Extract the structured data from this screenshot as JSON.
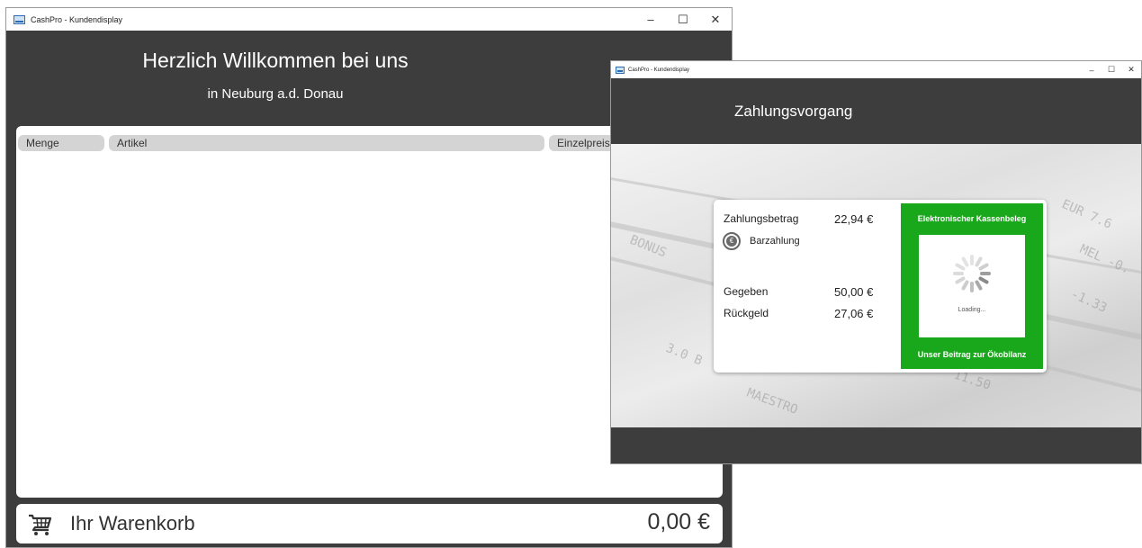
{
  "window1": {
    "title": "CashPro - Kundendisplay",
    "controls": {
      "minimize": "–",
      "maximize": "☐",
      "close": "✕"
    },
    "header": {
      "line1": "Herzlich Willkommen bei uns",
      "line2": "in Neuburg a.d. Donau"
    },
    "table": {
      "columns": [
        "Menge",
        "Artikel",
        "Einzelpreis"
      ]
    },
    "footer": {
      "cart_label": "Ihr Warenkorb",
      "total": "0,00 €",
      "icon": "shopping-cart-icon"
    }
  },
  "window2": {
    "title": "CashPro - Kundendisplay",
    "controls": {
      "minimize": "–",
      "maximize": "☐",
      "close": "✕"
    },
    "header_title": "Zahlungsvorgang",
    "payment": {
      "amount_label": "Zahlungsbetrag",
      "amount_value": "22,94 €",
      "method_label": "Barzahlung",
      "method_icon": "euro-coin-icon",
      "given_label": "Gegeben",
      "given_value": "50,00 €",
      "change_label": "Rückgeld",
      "change_value": "27,06 €"
    },
    "receipt_panel": {
      "top_label": "Elektronischer Kassenbeleg",
      "loading_text": "Loading...",
      "bottom_label": "Unser Beitrag zur Ökobilanz",
      "color": "#19a81b"
    }
  }
}
